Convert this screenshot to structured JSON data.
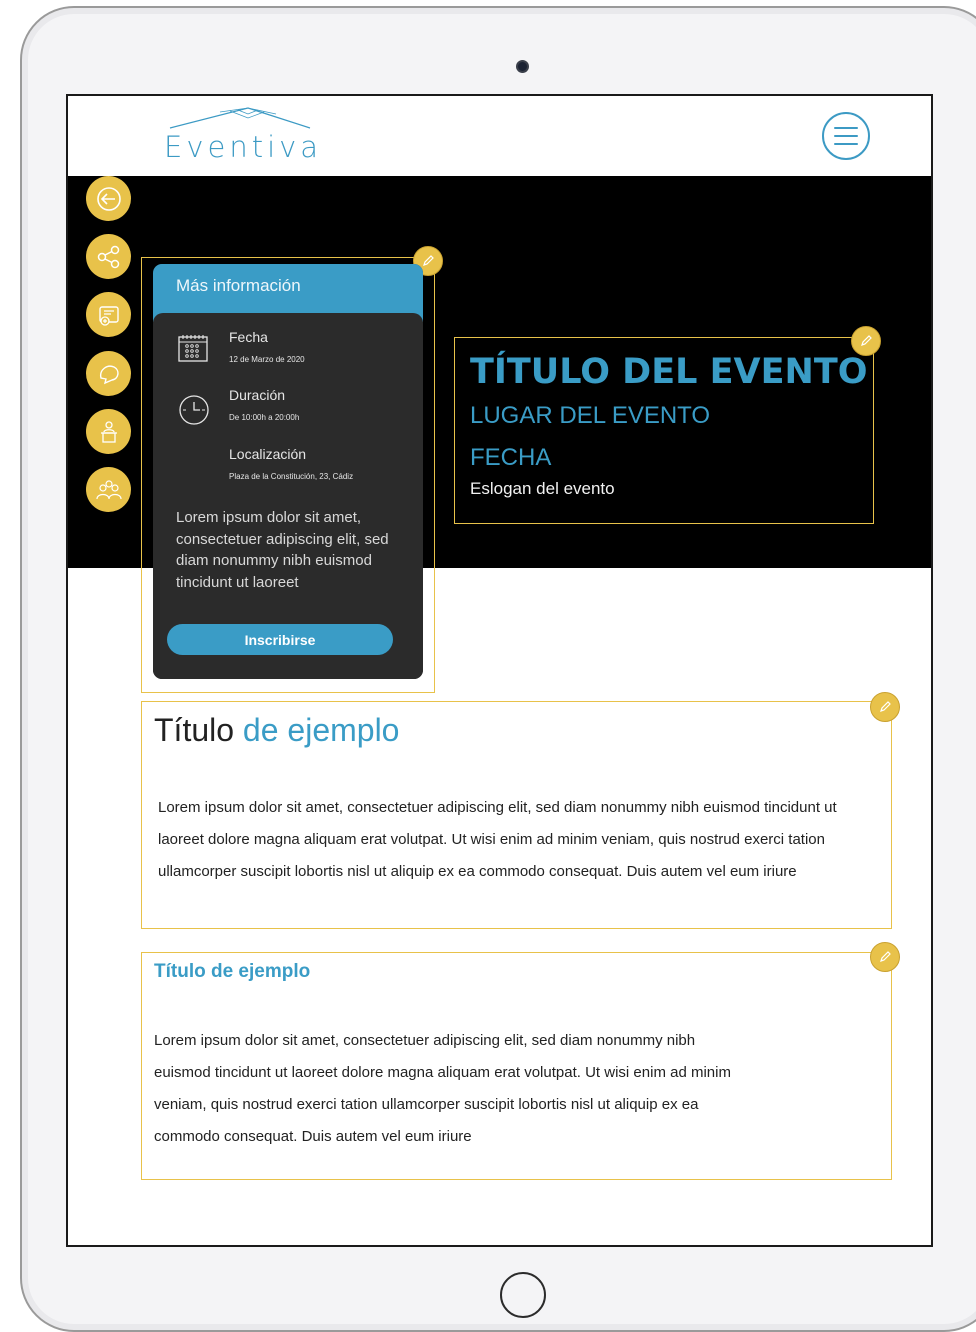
{
  "brand": {
    "logo_text": "Eventiva",
    "accent": "#3a9cc6",
    "gold": "#e8c24a"
  },
  "nav": {
    "menu_icon": "hamburger-icon",
    "side_icons": [
      "back-icon",
      "share-icon",
      "ticket-icon",
      "chat-icon",
      "podium-icon",
      "audience-icon"
    ]
  },
  "info_card": {
    "title": "Más información",
    "rows": [
      {
        "label": "Fecha",
        "value": "12 de Marzo de 2020",
        "icon": "calendar-icon"
      },
      {
        "label": "Duración",
        "value": "De 10:00h a 20:00h",
        "icon": "clock-icon"
      },
      {
        "label": "Localización",
        "value": "Plaza de la Constitución, 23, Cádiz"
      }
    ],
    "description": "Lorem ipsum dolor sit amet, consectetuer adipiscing elit, sed diam nonummy nibh euismod tincidunt ut laoreet",
    "button_label": "Inscribirse"
  },
  "event": {
    "title": "TÍTULO DEL EVENTO",
    "place": "LUGAR DEL EVENTO",
    "date": "FECHA",
    "slogan": "Eslogan del evento"
  },
  "section1": {
    "title_part1": "Título",
    "title_part2": "de ejemplo",
    "text": "Lorem ipsum dolor sit amet, consectetuer adipiscing elit, sed diam nonummy nibh euismod tincidunt ut laoreet dolore magna aliquam erat volutpat. Ut wisi enim ad minim veniam, quis nostrud exerci tation ullamcorper suscipit lobortis nisl ut aliquip ex ea commodo consequat. Duis autem vel eum iriure"
  },
  "section2": {
    "title": "Título de ejemplo",
    "text": "Lorem ipsum dolor sit amet, consectetuer adipiscing elit, sed diam nonummy nibh euismod tincidunt ut laoreet dolore magna aliquam erat volutpat. Ut wisi enim ad minim veniam, quis nostrud exerci tation ullamcorper suscipit lobortis nisl ut aliquip ex ea commodo consequat. Duis autem vel eum iriure"
  }
}
